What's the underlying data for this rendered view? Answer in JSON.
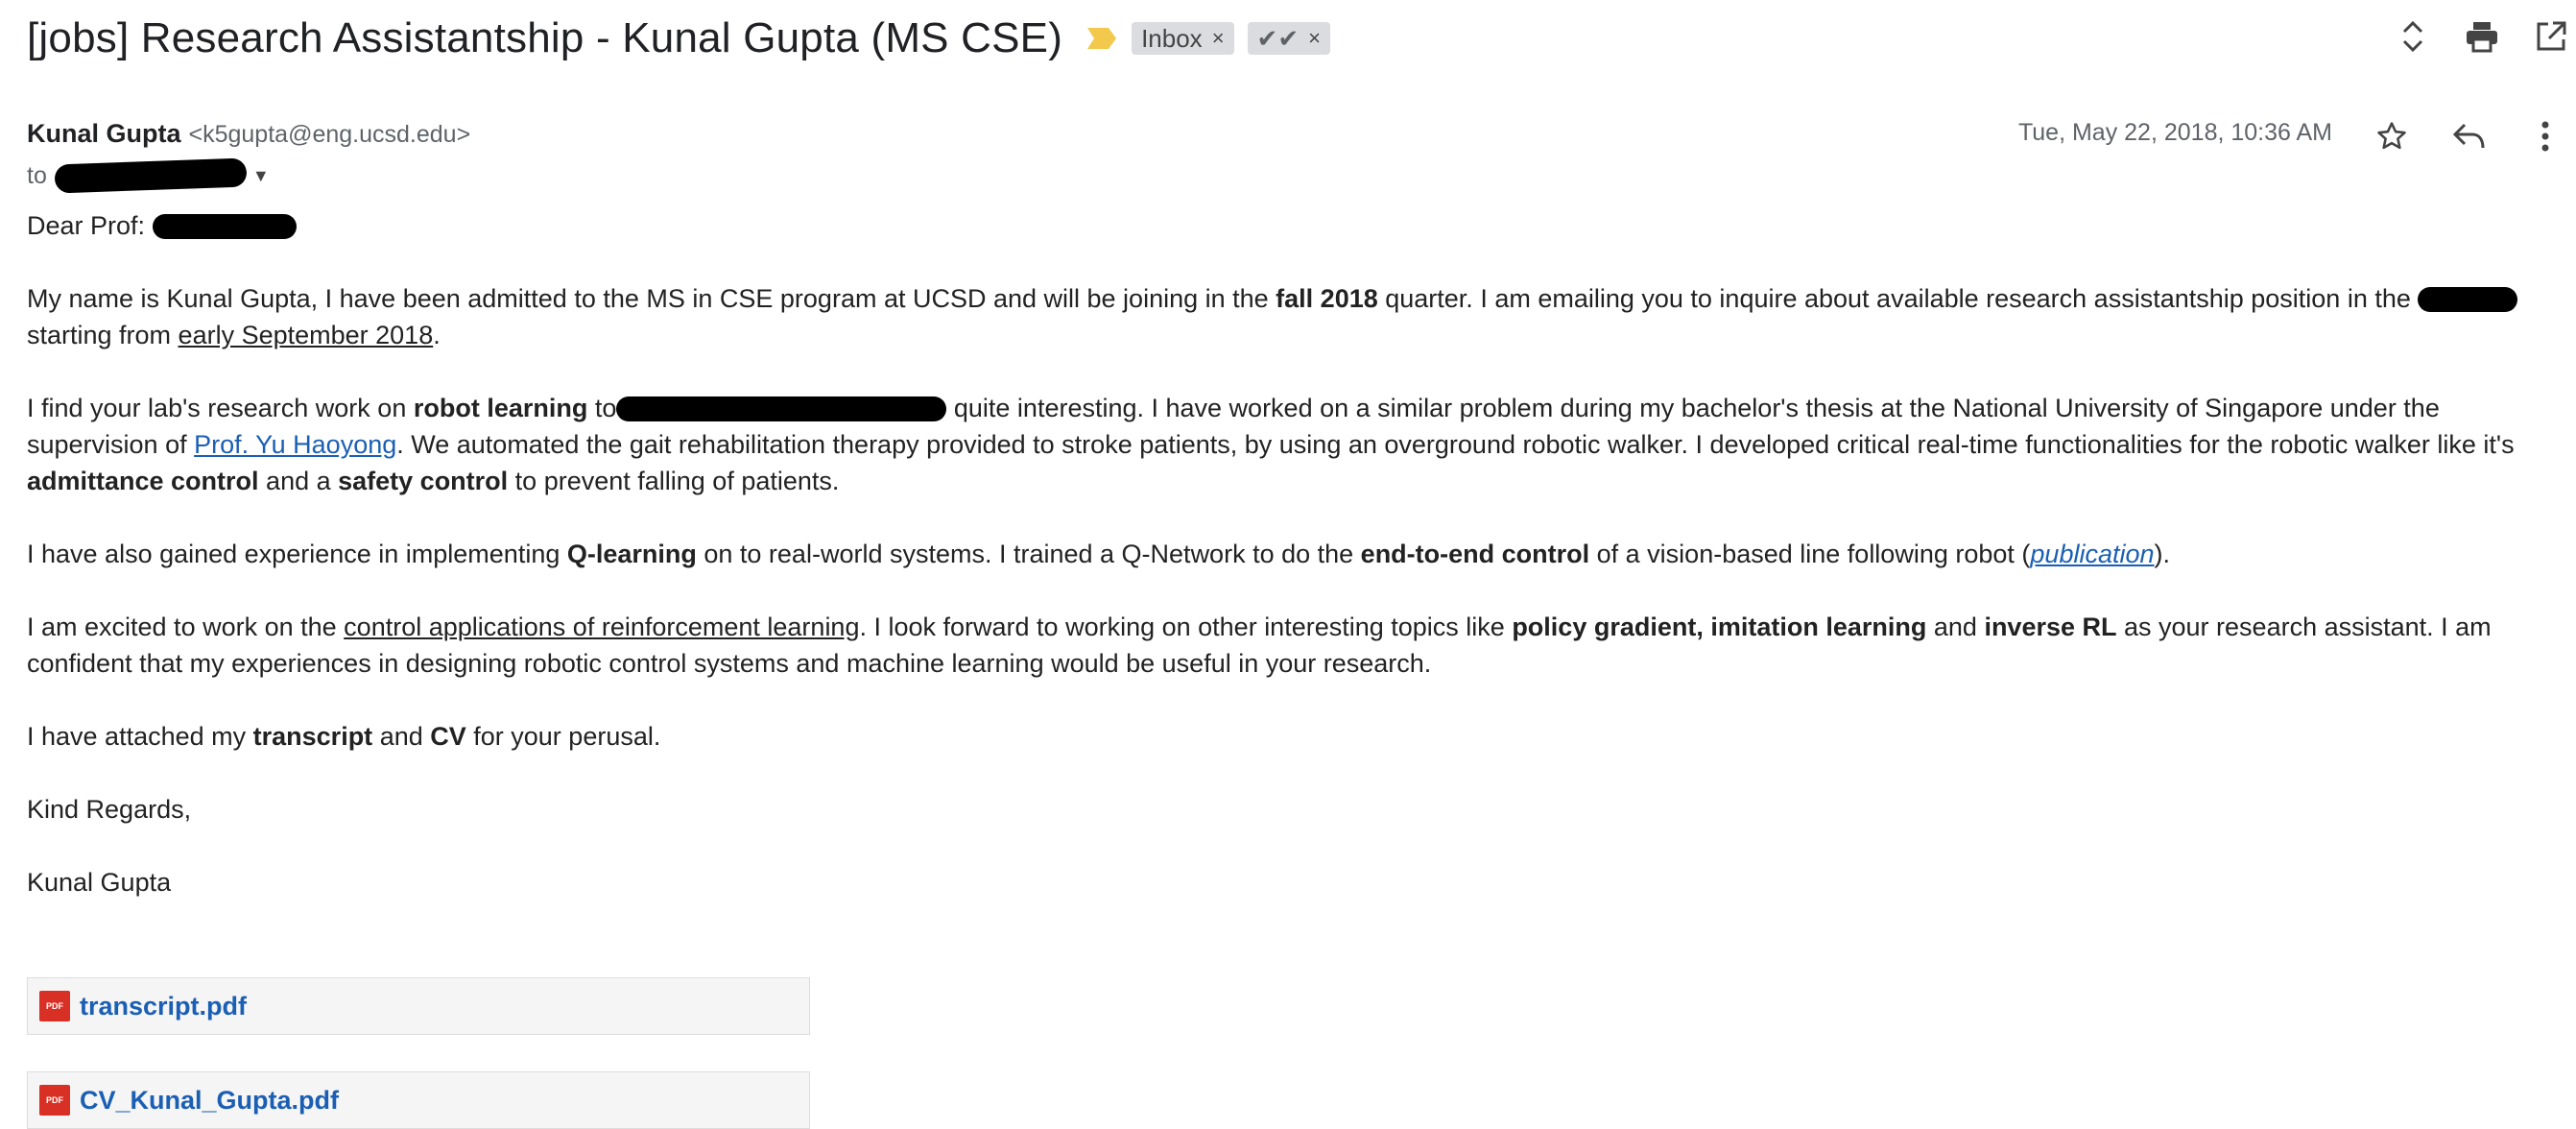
{
  "subject": {
    "title": "[jobs] Research Assistantship - Kunal Gupta (MS CSE)",
    "labels": [
      {
        "text": "Inbox",
        "remove": "×"
      },
      {
        "text": "✔✔",
        "remove": "×"
      }
    ],
    "icons": [
      "expand-collapse-icon",
      "print-icon",
      "open-in-new-window-icon"
    ]
  },
  "message": {
    "sender_name": "Kunal Gupta",
    "sender_email": "<k5gupta@eng.ucsd.edu>",
    "date": "Tue, May 22, 2018, 10:36 AM",
    "to_prefix": "to",
    "icons": [
      "star-icon",
      "reply-icon",
      "more-options-icon"
    ]
  },
  "body": {
    "greeting": "Dear Prof:",
    "p1": {
      "a": "My name is Kunal Gupta, I have been admitted to the MS in CSE program at UCSD and will be joining in the ",
      "b1": "fall 2018",
      "c": " quarter. I am emailing you to inquire about available research assistantship position in the ",
      "d": " starting from ",
      "u1": "early September 2018",
      "e": "."
    },
    "p2": {
      "a": "I find your lab's research work on ",
      "b1": "robot learning",
      "c": " to",
      "d": " quite interesting. I have worked on a similar problem during my bachelor's thesis at the National University of Singapore under the supervision of ",
      "link": "Prof. Yu Haoyong",
      "e": ". We automated the gait rehabilitation therapy provided to stroke patients, by using an overground robotic walker. I developed critical real-time functionalities for the robotic walker like it's ",
      "b2": "admittance control",
      "f": " and a ",
      "b3": "safety control",
      "g": " to prevent falling of patients."
    },
    "p3": {
      "a": "I have also gained experience in implementing ",
      "b1": "Q-learning",
      "c": " on to real-world systems. I trained a Q-Network to do the ",
      "b2": "end-to-end control",
      "d": " of a vision-based line following robot (",
      "link": "publication",
      "e": ")."
    },
    "p4": {
      "a": "I am excited to work on the ",
      "u1": "control applications of reinforcement learning",
      "c": ". I look forward to working on other interesting topics like ",
      "b1": "policy gradient, imitation learning",
      "d": " and ",
      "b2": "inverse RL",
      "e": " as your research assistant. I am confident that my experiences in designing robotic control systems and machine learning would be useful in your research."
    },
    "p5": {
      "a": "I have attached my ",
      "b1": "transcript",
      "c": " and ",
      "b2": "CV",
      "d": " for your perusal."
    },
    "closing": "Kind Regards,",
    "signature": "Kunal Gupta"
  },
  "attachments": [
    {
      "name": "transcript.pdf",
      "icon": "pdf-icon",
      "icon_text": "PDF"
    },
    {
      "name": "CV_Kunal_Gupta.pdf",
      "icon": "pdf-icon",
      "icon_text": "PDF"
    }
  ],
  "colors": {
    "link": "#1a5fb4",
    "important_marker": "#f2c94c",
    "label_bg": "#dadce0",
    "pdf_icon": "#d93025"
  }
}
